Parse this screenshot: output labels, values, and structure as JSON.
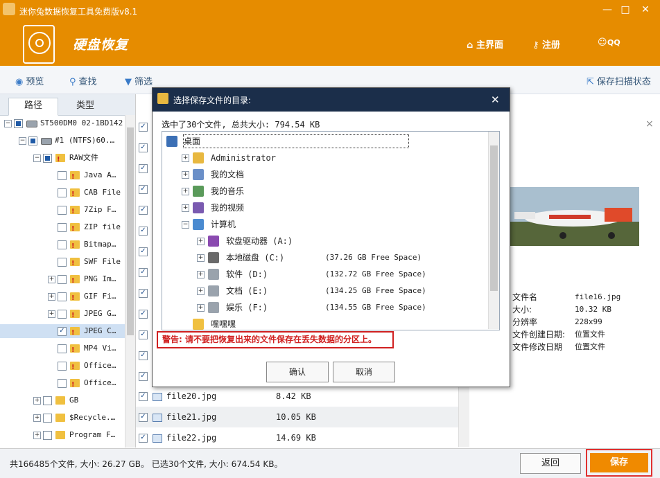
{
  "window": {
    "title": "迷你兔数据恢复工具免费版v8.1",
    "controls": [
      "—",
      "□",
      "✕"
    ]
  },
  "header": {
    "app_name": "硬盘恢复",
    "nav": [
      {
        "label": "主界面",
        "icon": "home-icon"
      },
      {
        "label": "注册",
        "icon": "key-icon"
      },
      {
        "label": "QQ",
        "icon": "qq-icon"
      }
    ]
  },
  "toolbar": {
    "preview": "预览",
    "find": "查找",
    "filter": "筛选",
    "save_scan": "保存扫描状态"
  },
  "left": {
    "tabs": [
      "路径",
      "类型"
    ],
    "tree": [
      {
        "label": "ST500DM0 02-1BD142",
        "level": 0,
        "check": "partial",
        "icon": "disk",
        "exp": "−"
      },
      {
        "label": "#1 (NTFS)60.…",
        "level": 1,
        "check": "partial",
        "icon": "disk",
        "exp": "−"
      },
      {
        "label": "RAW文件",
        "level": 2,
        "check": "partial",
        "icon": "folder-warn",
        "exp": "−"
      },
      {
        "label": "Java A…",
        "level": 3,
        "check": "none",
        "icon": "folder-warn",
        "exp": ""
      },
      {
        "label": "CAB File",
        "level": 3,
        "check": "none",
        "icon": "folder-warn",
        "exp": ""
      },
      {
        "label": "7Zip F…",
        "level": 3,
        "check": "none",
        "icon": "folder-warn",
        "exp": ""
      },
      {
        "label": "ZIP file",
        "level": 3,
        "check": "none",
        "icon": "folder-warn",
        "exp": ""
      },
      {
        "label": "Bitmap…",
        "level": 3,
        "check": "none",
        "icon": "folder-warn",
        "exp": ""
      },
      {
        "label": "SWF File",
        "level": 3,
        "check": "none",
        "icon": "folder-warn",
        "exp": ""
      },
      {
        "label": "PNG Im…",
        "level": 3,
        "check": "none",
        "icon": "folder-warn",
        "exp": "+"
      },
      {
        "label": "GIF Fi…",
        "level": 3,
        "check": "none",
        "icon": "folder-warn",
        "exp": "+"
      },
      {
        "label": "JPEG G…",
        "level": 3,
        "check": "none",
        "icon": "folder-warn",
        "exp": "+"
      },
      {
        "label": "JPEG C…",
        "level": 3,
        "check": "checked",
        "icon": "folder-warn",
        "exp": "",
        "selected": true
      },
      {
        "label": "MP4 Vi…",
        "level": 3,
        "check": "none",
        "icon": "folder-warn",
        "exp": ""
      },
      {
        "label": "Office…",
        "level": 3,
        "check": "none",
        "icon": "folder-warn",
        "exp": ""
      },
      {
        "label": "Office…",
        "level": 3,
        "check": "none",
        "icon": "folder-warn",
        "exp": ""
      },
      {
        "label": "GB",
        "level": 2,
        "check": "none",
        "icon": "folder-q",
        "exp": "+"
      },
      {
        "label": "$Recycle.…",
        "level": 2,
        "check": "none",
        "icon": "folder",
        "exp": "+"
      },
      {
        "label": "Program F…",
        "level": 2,
        "check": "none",
        "icon": "folder",
        "exp": "+"
      }
    ]
  },
  "files": {
    "rows": [
      {
        "name": "file20.jpg",
        "size": "8.42 KB"
      },
      {
        "name": "file21.jpg",
        "size": "10.05 KB"
      },
      {
        "name": "file22.jpg",
        "size": "14.69 KB"
      }
    ]
  },
  "preview": {
    "close": "×",
    "props": [
      {
        "label": "文件名",
        "value": "file16.jpg"
      },
      {
        "label": "大小:",
        "value": "10.32 KB"
      },
      {
        "label": "分辨率",
        "value": "228x99"
      },
      {
        "label": "文件创建日期:",
        "value": "位置文件"
      },
      {
        "label": "文件修改日期",
        "value": "位置文件"
      }
    ]
  },
  "status": {
    "text": "共166485个文件, 大小: 26.27 GB。 已选30个文件, 大小: 674.54 KB。",
    "back": "返回",
    "save": "保存"
  },
  "dialog": {
    "title": "选择保存文件的目录:",
    "close": "✕",
    "summary": "选中了30个文件, 总共大小: 794.54 KB",
    "tree": [
      {
        "label": "桌面",
        "indent": 0,
        "exp": "",
        "icon": "desktop",
        "free": ""
      },
      {
        "label": "Administrator",
        "indent": 1,
        "exp": "+",
        "icon": "user",
        "free": ""
      },
      {
        "label": "我的文档",
        "indent": 1,
        "exp": "+",
        "icon": "docs",
        "free": ""
      },
      {
        "label": "我的音乐",
        "indent": 1,
        "exp": "+",
        "icon": "music",
        "free": ""
      },
      {
        "label": "我的视频",
        "indent": 1,
        "exp": "+",
        "icon": "video",
        "free": ""
      },
      {
        "label": "计算机",
        "indent": 1,
        "exp": "−",
        "icon": "computer",
        "free": ""
      },
      {
        "label": "软盘驱动器 (A:)",
        "indent": 2,
        "exp": "+",
        "icon": "floppy",
        "free": ""
      },
      {
        "label": "本地磁盘 (C:)",
        "indent": 2,
        "exp": "+",
        "icon": "windrive",
        "free": "(37.26 GB Free Space)"
      },
      {
        "label": "软件 (D:)",
        "indent": 2,
        "exp": "+",
        "icon": "drive",
        "free": "(132.72 GB Free Space)"
      },
      {
        "label": "文档 (E:)",
        "indent": 2,
        "exp": "+",
        "icon": "drive",
        "free": "(134.25 GB Free Space)"
      },
      {
        "label": "娱乐 (F:)",
        "indent": 2,
        "exp": "+",
        "icon": "drive",
        "free": "(134.55 GB Free Space)"
      },
      {
        "label": "嘿嘿嘿",
        "indent": 1,
        "exp": "",
        "icon": "folder",
        "free": ""
      }
    ],
    "warning": "警告: 请不要把恢复出来的文件保存在丢失数据的分区上。",
    "ok": "确认",
    "cancel": "取消"
  },
  "colors": {
    "header": "#e68c00",
    "dialog_title": "#1b2e4a",
    "warning": "#d02020",
    "save_btn": "#f08a00"
  }
}
